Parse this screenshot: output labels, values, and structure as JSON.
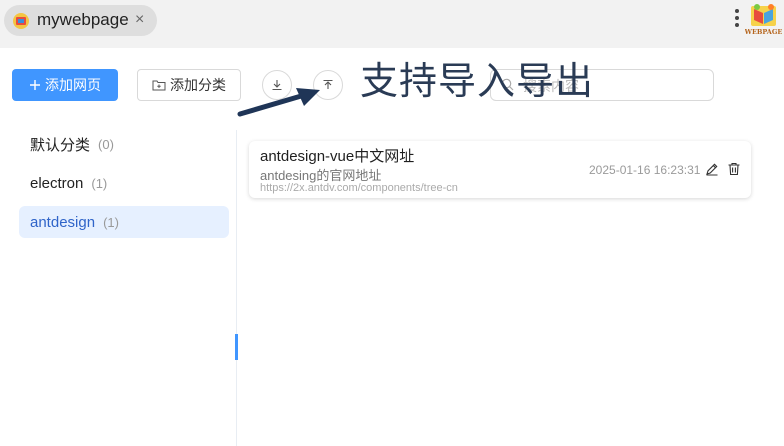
{
  "tab": {
    "title": "mywebpage",
    "close": "×"
  },
  "brand": {
    "logo_text": "WEBPAGE"
  },
  "toolbar": {
    "add_page_label": "添加网页",
    "add_category_label": "添加分类",
    "search_placeholder": "搜索内容"
  },
  "annotation": {
    "text": "支持导入导出"
  },
  "categories": [
    {
      "name": "默认分类",
      "count": "(0)"
    },
    {
      "name": "electron",
      "count": "(1)"
    },
    {
      "name": "antdesign",
      "count": "(1)",
      "active": true
    }
  ],
  "bookmarks": [
    {
      "title": "antdesign-vue中文网址",
      "description": "antdesing的官网地址",
      "url": "https://2x.antdv.com/components/tree-cn",
      "date": "2025-01-16 16:23:31"
    }
  ],
  "colors": {
    "primary": "#4096ff",
    "active_bg": "#e6f0ff",
    "active_text": "#2f64c9",
    "annotation": "#2a3b55"
  }
}
